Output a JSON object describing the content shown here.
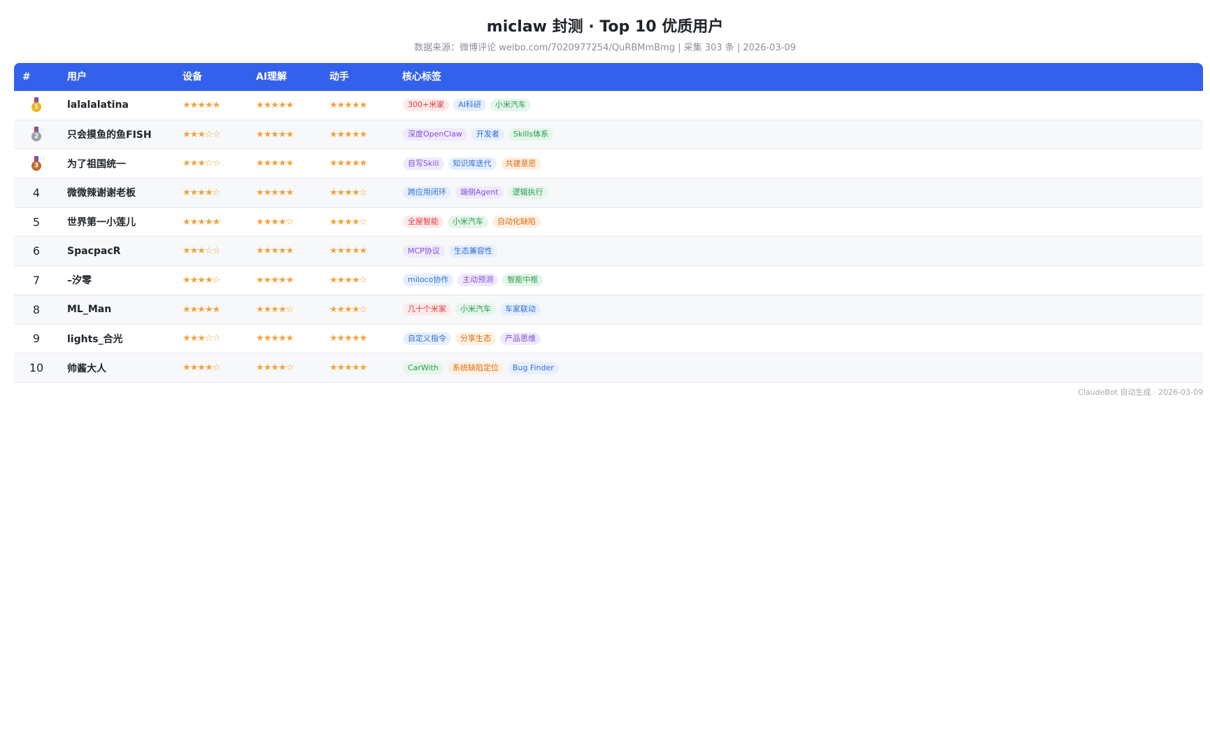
{
  "header": {
    "title": "miclaw 封测 · Top 10 优质用户",
    "subtitle": "数据来源：微博评论 weibo.com/7020977254/QuRBMmBmg | 采集 303 条 | 2026-03-09"
  },
  "table": {
    "columns": [
      "#",
      "用户",
      "设备",
      "AI理解",
      "动手",
      "核心标签"
    ],
    "rows": [
      {
        "rank": "1",
        "medal": "gold",
        "user": "lalalalatina",
        "device": 5,
        "ai": 5,
        "hands_on": 5,
        "tags": [
          {
            "label": "300+米家",
            "color": "red"
          },
          {
            "label": "AI科研",
            "color": "blue"
          },
          {
            "label": "小米汽车",
            "color": "green"
          }
        ]
      },
      {
        "rank": "2",
        "medal": "silver",
        "user": "只会摸鱼的鱼FISH",
        "device": 3,
        "ai": 5,
        "hands_on": 5,
        "tags": [
          {
            "label": "深度OpenClaw",
            "color": "purple"
          },
          {
            "label": "开发者",
            "color": "blue"
          },
          {
            "label": "Skills体系",
            "color": "green"
          }
        ]
      },
      {
        "rank": "3",
        "medal": "bronze",
        "user": "为了祖国统一",
        "device": 3,
        "ai": 5,
        "hands_on": 5,
        "tags": [
          {
            "label": "自写Skill",
            "color": "purple"
          },
          {
            "label": "知识库迭代",
            "color": "blue"
          },
          {
            "label": "共建意愿",
            "color": "orange"
          }
        ]
      },
      {
        "rank": "4",
        "medal": "",
        "user": "微微辣谢谢老板",
        "device": 4,
        "ai": 5,
        "hands_on": 4,
        "tags": [
          {
            "label": "跨应用闭环",
            "color": "blue"
          },
          {
            "label": "端侧Agent",
            "color": "purple"
          },
          {
            "label": "逻辑执行",
            "color": "green"
          }
        ]
      },
      {
        "rank": "5",
        "medal": "",
        "user": "世界第一小莲儿",
        "device": 5,
        "ai": 4,
        "hands_on": 4,
        "tags": [
          {
            "label": "全屋智能",
            "color": "red"
          },
          {
            "label": "小米汽车",
            "color": "green"
          },
          {
            "label": "自动化缺陷",
            "color": "orange"
          }
        ]
      },
      {
        "rank": "6",
        "medal": "",
        "user": "SpacpacR",
        "device": 3,
        "ai": 5,
        "hands_on": 5,
        "tags": [
          {
            "label": "MCP协议",
            "color": "purple"
          },
          {
            "label": "生态兼容性",
            "color": "blue"
          }
        ]
      },
      {
        "rank": "7",
        "medal": "",
        "user": "–汐零",
        "device": 4,
        "ai": 5,
        "hands_on": 4,
        "tags": [
          {
            "label": "miloco协作",
            "color": "blue"
          },
          {
            "label": "主动预测",
            "color": "purple"
          },
          {
            "label": "智能中枢",
            "color": "green"
          }
        ]
      },
      {
        "rank": "8",
        "medal": "",
        "user": "ML_Man",
        "device": 5,
        "ai": 4,
        "hands_on": 4,
        "tags": [
          {
            "label": "几十个米家",
            "color": "red"
          },
          {
            "label": "小米汽车",
            "color": "green"
          },
          {
            "label": "车家联动",
            "color": "blue"
          }
        ]
      },
      {
        "rank": "9",
        "medal": "",
        "user": "lights_合光",
        "device": 3,
        "ai": 5,
        "hands_on": 5,
        "tags": [
          {
            "label": "自定义指令",
            "color": "blue"
          },
          {
            "label": "分享生态",
            "color": "orange"
          },
          {
            "label": "产品思维",
            "color": "purple"
          }
        ]
      },
      {
        "rank": "10",
        "medal": "",
        "user": "帅酱大人",
        "device": 4,
        "ai": 4,
        "hands_on": 5,
        "tags": [
          {
            "label": "CarWith",
            "color": "green"
          },
          {
            "label": "系统缺陷定位",
            "color": "orange"
          },
          {
            "label": "Bug Finder",
            "color": "blue"
          }
        ]
      }
    ]
  },
  "colors": {
    "header_bg": "#3461ec",
    "star": "#f2a33a",
    "tag_red": {
      "bg": "#fdeaea",
      "fg": "#e03a3a"
    },
    "tag_blue": {
      "bg": "#e6effd",
      "fg": "#2f6fd6"
    },
    "tag_green": {
      "bg": "#e5f6ea",
      "fg": "#2a9a4f"
    },
    "tag_purple": {
      "bg": "#f1eafd",
      "fg": "#7c4fd6"
    },
    "tag_orange": {
      "bg": "#fdf0e2",
      "fg": "#dd6c12"
    },
    "medal_gold": "#f0b322",
    "medal_silver": "#9aa1ab",
    "medal_bronze": "#c0692c"
  },
  "footer": {
    "text": "ClaudeBot 自动生成 · 2026-03-09"
  }
}
